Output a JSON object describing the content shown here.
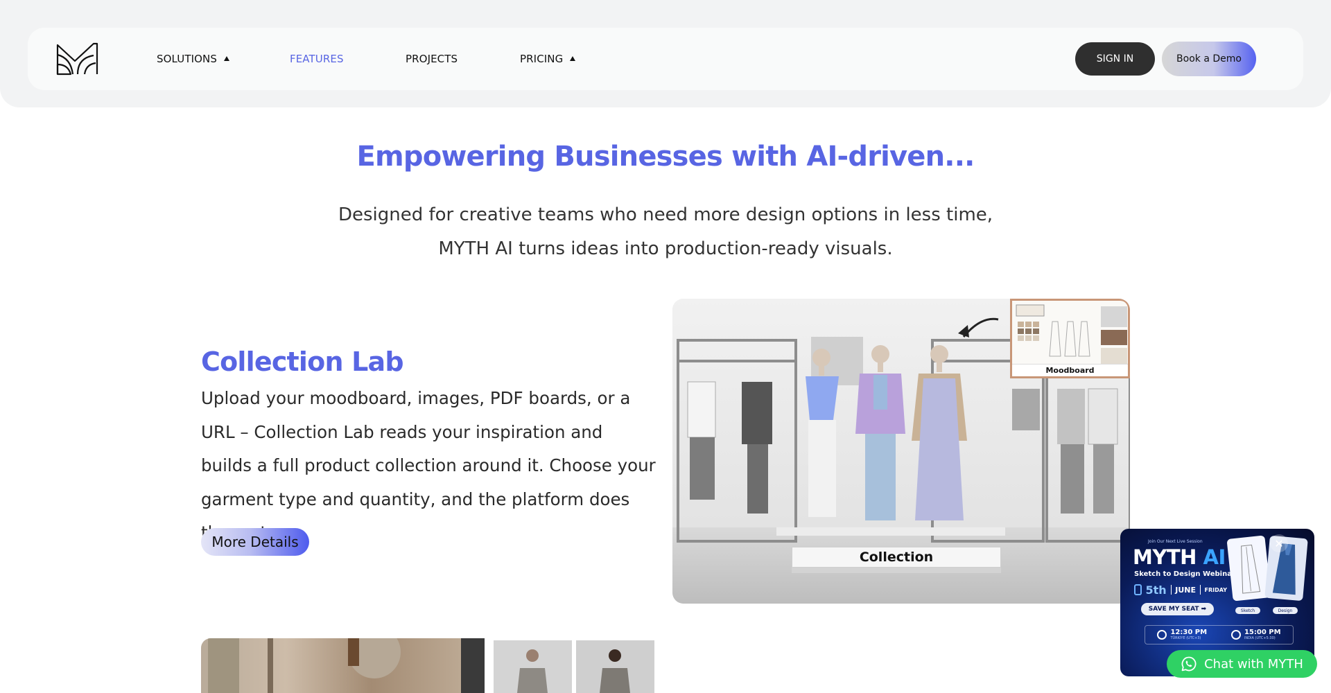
{
  "nav": {
    "items": [
      {
        "label": "SOLUTIONS",
        "has_caret": true,
        "active": false
      },
      {
        "label": "FEATURES",
        "has_caret": false,
        "active": true
      },
      {
        "label": "PROJECTS",
        "has_caret": false,
        "active": false
      },
      {
        "label": "PRICING",
        "has_caret": true,
        "active": false
      }
    ],
    "sign_in_label": "SIGN IN",
    "demo_label": "Book a Demo"
  },
  "hero": {
    "title": "Empowering Businesses with AI-driven...",
    "subtitle_line1": "Designed for creative teams who need more design options in less time,",
    "subtitle_line2": "MYTH AI turns ideas into production-ready visuals."
  },
  "collection_lab": {
    "title": "Collection Lab",
    "body": "Upload your moodboard, images, PDF boards, or a URL – Collection Lab reads your inspiration and builds a full product collection around it. Choose your garment type and quantity, and the platform does the rest.",
    "button_label": "More Details",
    "image": {
      "collection_label": "Collection",
      "moodboard_label": "Moodboard"
    }
  },
  "popup": {
    "kicker": "Join Our Next Live Session",
    "title_main": "MYTH",
    "title_accent": "AI",
    "subtitle": "Sketch to Design Webinar",
    "day": "5th",
    "month": "JUNE",
    "weekday": "FRIDAY",
    "seat_label": "SAVE MY SEAT ➡",
    "time1": "12:30 PM",
    "zone1": "TÜRKIYE (UTC+3)",
    "time2": "15:00 PM",
    "zone2": "INDIA (UTC+5:30)",
    "sketch_label": "Sketch",
    "design_label": "Design",
    "close_glyph": "✕"
  },
  "chat": {
    "label": "Chat with MYTH"
  },
  "colors": {
    "accent": "#5865e3",
    "dark_button": "#2f2f2f",
    "whatsapp": "#2fd164"
  },
  "icons": {
    "logo": "myth-logo-icon",
    "chat": "whatsapp-icon",
    "close": "close-icon",
    "caret": "caret-up-icon"
  }
}
